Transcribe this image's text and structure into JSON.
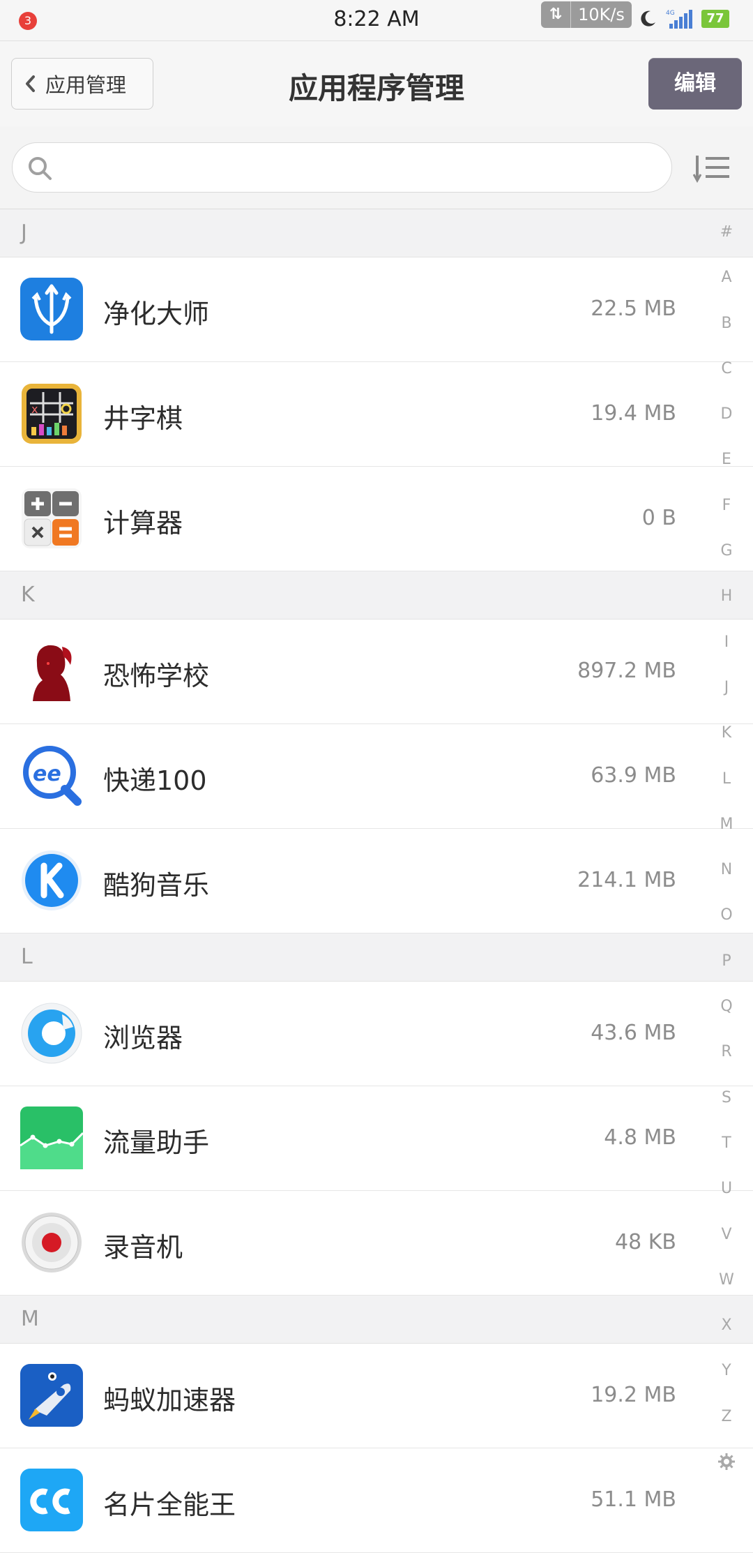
{
  "status": {
    "notification_count": "3",
    "time": "8:22 AM",
    "net_speed": "10K/s",
    "network_type": "4G",
    "battery": "77"
  },
  "nav": {
    "back_label": "应用管理",
    "title": "应用程序管理",
    "edit_label": "编辑"
  },
  "search": {
    "placeholder": ""
  },
  "sections": [
    {
      "letter": "J",
      "apps": [
        {
          "name": "净化大师",
          "size": "22.5 MB",
          "icon": "trident-shield-icon"
        },
        {
          "name": "井字棋",
          "size": "19.4 MB",
          "icon": "tic-tac-toe-icon"
        },
        {
          "name": "计算器",
          "size": "0 B",
          "icon": "calculator-icon"
        }
      ]
    },
    {
      "letter": "K",
      "apps": [
        {
          "name": "恐怖学校",
          "size": "897.2 MB",
          "icon": "horror-girl-icon"
        },
        {
          "name": "快递100",
          "size": "63.9 MB",
          "icon": "express-search-icon"
        },
        {
          "name": "酷狗音乐",
          "size": "214.1 MB",
          "icon": "kugou-k-icon"
        }
      ]
    },
    {
      "letter": "L",
      "apps": [
        {
          "name": "浏览器",
          "size": "43.6 MB",
          "icon": "browser-icon"
        },
        {
          "name": "流量助手",
          "size": "4.8 MB",
          "icon": "data-traffic-icon"
        },
        {
          "name": "录音机",
          "size": "48 KB",
          "icon": "recorder-icon"
        }
      ]
    },
    {
      "letter": "M",
      "apps": [
        {
          "name": "蚂蚁加速器",
          "size": "19.2 MB",
          "icon": "ant-rocket-icon"
        },
        {
          "name": "名片全能王",
          "size": "51.1 MB",
          "icon": "camcard-icon"
        }
      ]
    }
  ],
  "index_letters": [
    "#",
    "A",
    "B",
    "C",
    "D",
    "E",
    "F",
    "G",
    "H",
    "I",
    "J",
    "K",
    "L",
    "M",
    "N",
    "O",
    "P",
    "Q",
    "R",
    "S",
    "T",
    "U",
    "V",
    "W",
    "X",
    "Y",
    "Z"
  ],
  "colors": {
    "edit_button": "#6b6779",
    "notification": "#e8403a",
    "battery": "#7ac63a"
  }
}
